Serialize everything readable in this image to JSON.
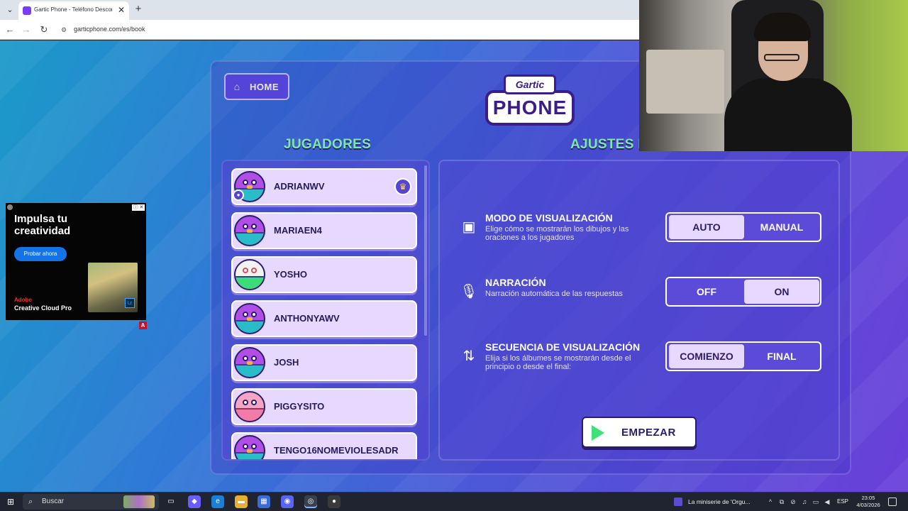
{
  "browser": {
    "tab_title": "Gartic Phone - Teléfono Descon",
    "tab_close": "✕",
    "new_tab": "+",
    "url": "garticphone.com/es/book"
  },
  "game": {
    "home_label": "HOME",
    "logo_top": "Gartic",
    "logo_bottom": "PHONE",
    "players_heading": "JUGADORES",
    "settings_heading": "AJUSTES D",
    "players": [
      {
        "name": "ADRIANWV",
        "avatar": "blue-bird-avatar",
        "host": true
      },
      {
        "name": "MARIAEN4",
        "avatar": "blue-bird-avatar",
        "host": false
      },
      {
        "name": "YOSHO",
        "avatar": "green-target-avatar",
        "host": false
      },
      {
        "name": "ANTHONYAWV",
        "avatar": "blue-bird-avatar",
        "host": false
      },
      {
        "name": "JOSH",
        "avatar": "blue-bird-avatar",
        "host": false
      },
      {
        "name": "PIGGYSITO",
        "avatar": "pink-pig-avatar",
        "host": false
      },
      {
        "name": "TENGO16NOMEVIOLESADR",
        "avatar": "blue-bird-avatar",
        "host": false
      }
    ],
    "settings": [
      {
        "title": "MODO DE VISUALIZACIÓN",
        "description": "Elige cómo se mostrarán los dibujos y las oraciones a los jugadores",
        "icon": "image-icon",
        "options": [
          "AUTO",
          "MANUAL"
        ],
        "selected": "AUTO"
      },
      {
        "title": "NARRACIÓN",
        "description": "Narración automática de las respuestas",
        "icon": "microphone-icon",
        "options": [
          "OFF",
          "ON"
        ],
        "selected": "ON"
      },
      {
        "title": "SECUENCIA DE VISUALIZACIÓN",
        "description": "Elija si los álbumes se mostrarán desde el principio o desde el final:",
        "icon": "sort-arrows-icon",
        "options": [
          "COMIENZO",
          "FINAL"
        ],
        "selected": "COMIENZO"
      }
    ],
    "start_label": "EMPEZAR"
  },
  "ad": {
    "headline": "Impulsa tu creatividad",
    "cta": "Probar ahora",
    "brand": "Adobe",
    "product": "Creative Cloud Pro",
    "lr_badge": "Lr",
    "flag": "A"
  },
  "taskbar": {
    "search_placeholder": "Buscar",
    "media_text": "La miniserie de 'Orgu...",
    "language": "ESP",
    "time": "23:05",
    "date": "4/03/2026"
  },
  "colors": {
    "accent": "#5444d8",
    "heading": "#7ee7a8",
    "row_bg": "#e6d8ff",
    "start_icon": "#3ee07a"
  }
}
